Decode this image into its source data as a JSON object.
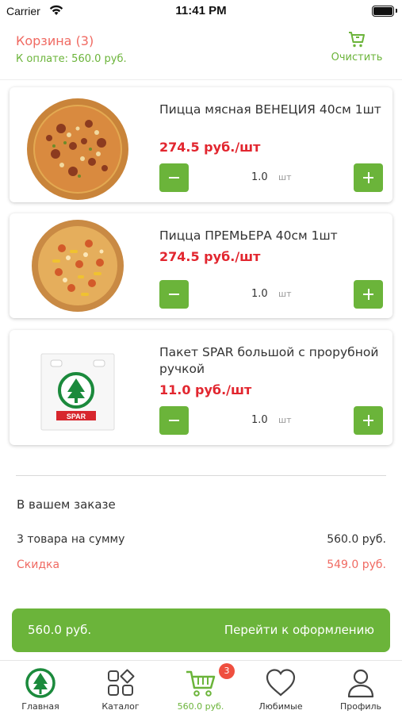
{
  "status_bar": {
    "carrier": "Carrier",
    "time": "11:41 PM"
  },
  "header": {
    "title": "Корзина (3)",
    "total": "К оплате:  560.0 руб.",
    "clear_label": "Очистить"
  },
  "cart_items": [
    {
      "name": "Пицца мясная ВЕНЕЦИЯ 40см 1шт",
      "price": "274.5 руб./шт",
      "qty": "1.0",
      "unit": "шт",
      "image": "pizza-venezia"
    },
    {
      "name": "Пицца ПРЕМЬЕРА 40см 1шт",
      "price": "274.5 руб./шт",
      "qty": "1.0",
      "unit": "шт",
      "image": "pizza-premiera"
    },
    {
      "name": "Пакет SPAR большой с прорубной ручкой",
      "price": "11.0 руб./шт",
      "qty": "1.0",
      "unit": "шт",
      "image": "spar-bag",
      "logo_text": "SPAR"
    }
  ],
  "summary": {
    "title": "В вашем заказе",
    "items_label": "3 товара на сумму",
    "items_value": "560.0 руб.",
    "discount_label": "Скидка",
    "discount_value": "549.0 руб."
  },
  "checkout": {
    "amount": "560.0 руб.",
    "label": "Перейти к оформлению"
  },
  "tabbar": {
    "tabs": [
      {
        "label": "Главная",
        "icon": "spar-logo-icon"
      },
      {
        "label": "Каталог",
        "icon": "catalog-icon"
      },
      {
        "label": "560.0 руб.",
        "icon": "cart-icon",
        "active": true
      },
      {
        "label": "Любимые",
        "icon": "heart-icon"
      },
      {
        "label": "Профиль",
        "icon": "profile-icon"
      }
    ],
    "cart_badge": "3"
  },
  "colors": {
    "accent_green": "#6bb43a",
    "price_red": "#e2262f",
    "discount_red": "#f06a62",
    "badge_red": "#ef4f3f"
  }
}
